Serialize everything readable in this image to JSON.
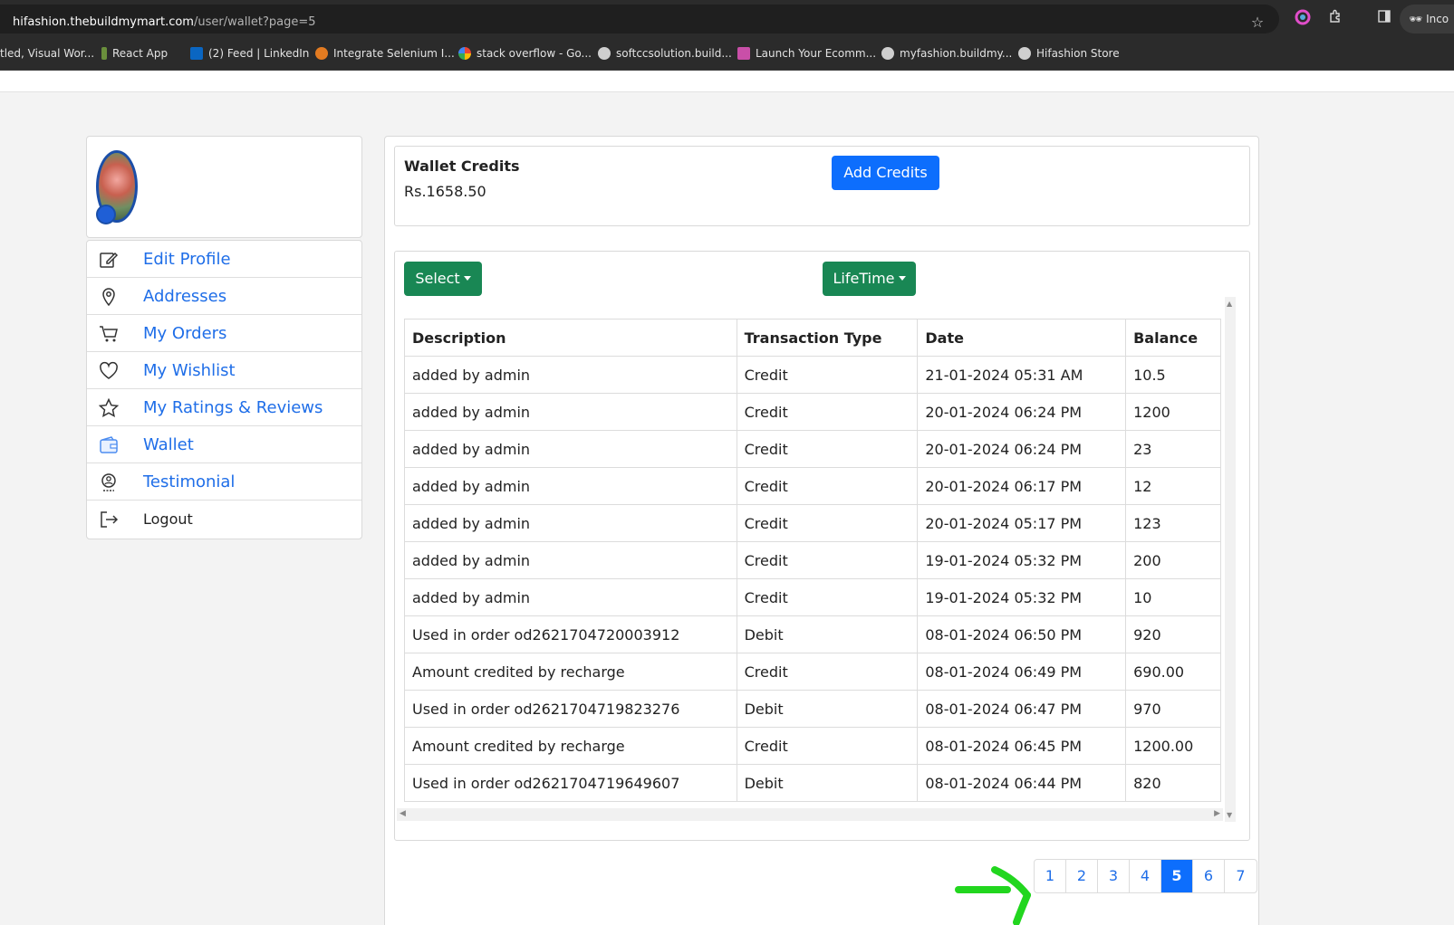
{
  "browser": {
    "url_host": "hifashion.thebuildmymart.com",
    "url_path": "/user/wallet?page=5",
    "incognito_label": "Inco",
    "bookmarks": [
      {
        "label": "tled, Visual Wor...",
        "color": "#2b2b2b"
      },
      {
        "label": "React App",
        "color": "#6a8f3c"
      },
      {
        "label": "(2) Feed | LinkedIn",
        "color": "#0a66c2"
      },
      {
        "label": "Integrate Selenium I...",
        "color": "#e37b21"
      },
      {
        "label": "stack overflow - Go...",
        "color": "#ffffff"
      },
      {
        "label": "softccsolution.build...",
        "color": "#cfcfcf"
      },
      {
        "label": "Launch Your Ecomm...",
        "color": "#c94fa8"
      },
      {
        "label": "myfashion.buildmy...",
        "color": "#cfcfcf"
      },
      {
        "label": "Hifashion Store",
        "color": "#cfcfcf"
      }
    ]
  },
  "sidebar": {
    "items": [
      {
        "label": "Edit Profile",
        "icon": "edit-icon"
      },
      {
        "label": "Addresses",
        "icon": "location-pin-icon"
      },
      {
        "label": "My Orders",
        "icon": "cart-icon"
      },
      {
        "label": "My Wishlist",
        "icon": "heart-icon"
      },
      {
        "label": "My Ratings & Reviews",
        "icon": "star-icon"
      },
      {
        "label": "Wallet",
        "icon": "wallet-icon"
      },
      {
        "label": "Testimonial",
        "icon": "award-icon"
      },
      {
        "label": "Logout",
        "icon": "logout-icon"
      }
    ]
  },
  "wallet": {
    "title": "Wallet Credits",
    "amount": "Rs.1658.50",
    "add_button": "Add Credits"
  },
  "filters": {
    "select_label": "Select",
    "period_label": "LifeTime"
  },
  "table": {
    "headers": [
      "Description",
      "Transaction Type",
      "Date",
      "Balance"
    ],
    "rows": [
      [
        "added by admin",
        "Credit",
        "21-01-2024 05:31 AM",
        "10.5"
      ],
      [
        "added by admin",
        "Credit",
        "20-01-2024 06:24 PM",
        "1200"
      ],
      [
        "added by admin",
        "Credit",
        "20-01-2024 06:24 PM",
        "23"
      ],
      [
        "added by admin",
        "Credit",
        "20-01-2024 06:17 PM",
        "12"
      ],
      [
        "added by admin",
        "Credit",
        "20-01-2024 05:17 PM",
        "123"
      ],
      [
        "added by admin",
        "Credit",
        "19-01-2024 05:32 PM",
        "200"
      ],
      [
        "added by admin",
        "Credit",
        "19-01-2024 05:32 PM",
        "10"
      ],
      [
        "Used in order od2621704720003912",
        "Debit",
        "08-01-2024 06:50 PM",
        "920"
      ],
      [
        "Amount credited by recharge",
        "Credit",
        "08-01-2024 06:49 PM",
        "690.00"
      ],
      [
        "Used in order od2621704719823276",
        "Debit",
        "08-01-2024 06:47 PM",
        "970"
      ],
      [
        "Amount credited by recharge",
        "Credit",
        "08-01-2024 06:45 PM",
        "1200.00"
      ],
      [
        "Used in order od2621704719649607",
        "Debit",
        "08-01-2024 06:44 PM",
        "820"
      ]
    ]
  },
  "pagination": {
    "pages": [
      "1",
      "2",
      "3",
      "4",
      "5",
      "6",
      "7"
    ],
    "active": "5"
  },
  "colors": {
    "primary": "#0d6efd",
    "success": "#198754",
    "link": "#1f6ee8",
    "annotation_arrow": "#22d61f"
  }
}
